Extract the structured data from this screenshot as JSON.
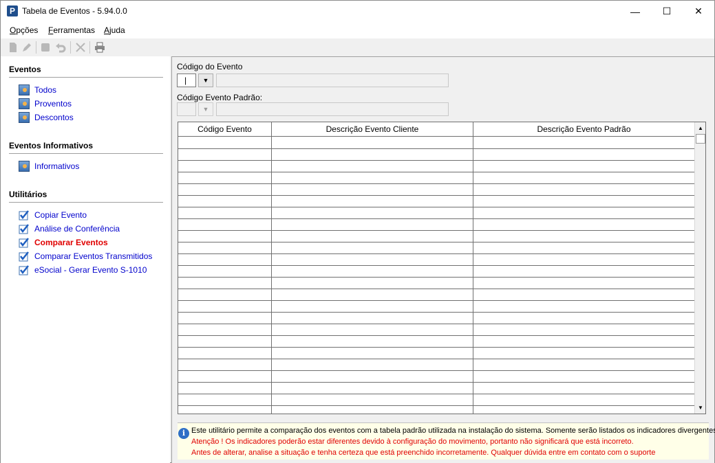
{
  "window": {
    "title": "Tabela de Eventos - 5.94.0.0",
    "app_icon_letter": "P",
    "controls": {
      "minimize": "—",
      "maximize": "☐",
      "close": "✕"
    }
  },
  "menu": {
    "items": [
      {
        "first": "O",
        "rest": "pções"
      },
      {
        "first": "F",
        "rest": "erramentas"
      },
      {
        "first": "A",
        "rest": "juda"
      }
    ]
  },
  "toolbar": {
    "icons": [
      "new-document-icon",
      "edit-icon",
      "stop-icon",
      "undo-icon",
      "delete-icon",
      "print-icon"
    ]
  },
  "sidebar": {
    "sections": [
      {
        "title": "Eventos",
        "items": [
          "Todos",
          "Proventos",
          "Descontos"
        ]
      },
      {
        "title": "Eventos Informativos",
        "items": [
          "Informativos"
        ]
      },
      {
        "title": "Utilitários",
        "items": [
          "Copiar Evento",
          "Análise de Conferência",
          "Comparar Eventos",
          "Comparar Eventos Transmitidos",
          "eSocial - Gerar Evento S-1010"
        ]
      }
    ],
    "active_item": "Comparar Eventos"
  },
  "form": {
    "codigo_evento_label": "Código do Evento",
    "codigo_evento_value": "|",
    "codigo_padrao_label": "Código Evento Padrão:",
    "dropdown_arrow": "▼"
  },
  "grid": {
    "columns": [
      "Código Evento",
      "Descrição Evento Cliente",
      "Descrição Evento Padrão"
    ],
    "rows": [],
    "scroll_up": "▲",
    "scroll_down": "▼"
  },
  "info": {
    "icon_text": "i",
    "line1": "Este utilitário permite a comparação dos eventos com a tabela padrão utilizada na instalação do sistema. Somente serão listados os indicadores divergentes.",
    "line2": "Atenção ! Os indicadores poderão estar diferentes devido à configuração do movimento, portanto não significará que está incorreto.",
    "line3": "Antes de alterar, analise a situação e tenha certeza que está preenchido incorretamente. Qualquer dúvida entre em contato com o suporte",
    "line1_color": "#000000",
    "warning_color": "#e00000"
  },
  "colors": {
    "link": "#0000cc",
    "active_link": "#e00000",
    "app_icon": "#1f4e8c"
  }
}
